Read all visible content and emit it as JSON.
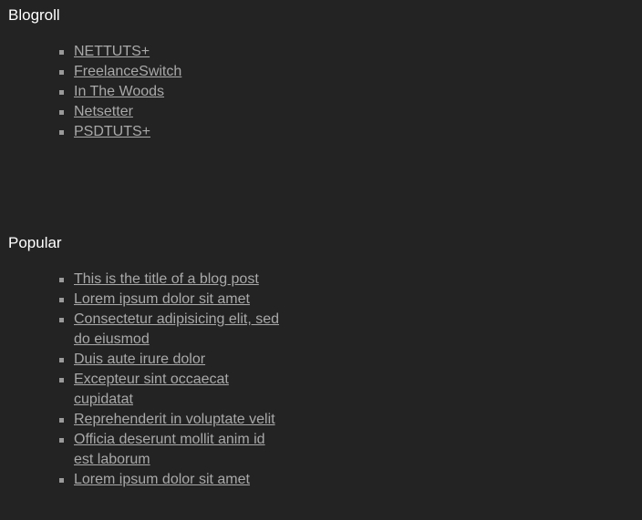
{
  "blogroll": {
    "title": "Blogroll",
    "items": [
      {
        "label": "NETTUTS+"
      },
      {
        "label": "FreelanceSwitch"
      },
      {
        "label": "In The Woods"
      },
      {
        "label": "Netsetter"
      },
      {
        "label": "PSDTUTS+"
      }
    ]
  },
  "popular": {
    "title": "Popular",
    "items": [
      {
        "label": "This is the title of a blog post"
      },
      {
        "label": "Lorem ipsum dolor sit amet"
      },
      {
        "label": "Consectetur adipisicing elit, sed do eiusmod"
      },
      {
        "label": "Duis aute irure dolor"
      },
      {
        "label": "Excepteur sint occaecat cupidatat"
      },
      {
        "label": "Reprehenderit in voluptate velit"
      },
      {
        "label": "Officia deserunt mollit anim id est laborum"
      },
      {
        "label": "Lorem ipsum dolor sit amet"
      }
    ]
  },
  "colors": {
    "background": "#232323",
    "heading": "#ffffff",
    "link": "#a9a9a9"
  }
}
